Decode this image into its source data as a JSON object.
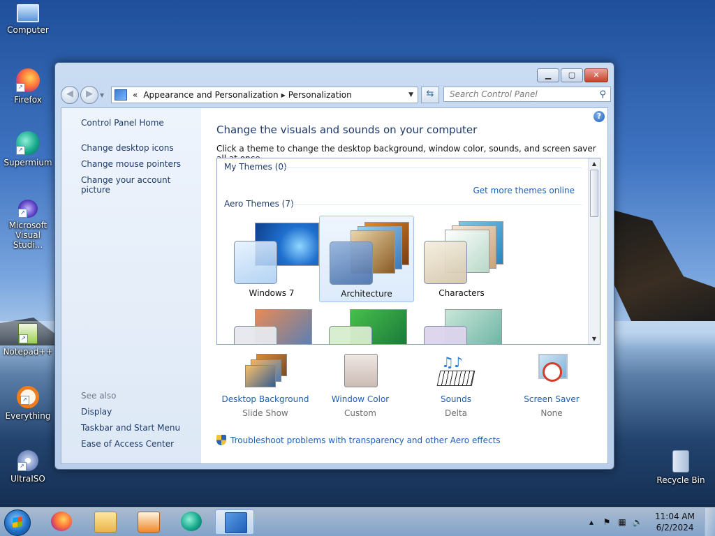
{
  "desktop": {
    "icons": [
      {
        "label": "Computer",
        "icon": "computer-icon"
      },
      {
        "label": "Firefox",
        "icon": "firefox-icon"
      },
      {
        "label": "Supermium",
        "icon": "supermium-icon"
      },
      {
        "label_line1": "Microsoft",
        "label_line2": "Visual Studi...",
        "icon": "visual-studio-icon"
      },
      {
        "label": "Notepad++",
        "icon": "notepad-plus-plus-icon"
      },
      {
        "label": "Everything",
        "icon": "everything-search-icon"
      },
      {
        "label": "UltraISO",
        "icon": "ultraiso-icon"
      },
      {
        "label": "Recycle Bin",
        "icon": "recycle-bin-icon"
      }
    ]
  },
  "window": {
    "address": {
      "chevron": "«",
      "crumbs": [
        "Appearance and Personalization",
        "Personalization"
      ]
    },
    "search_placeholder": "Search Control Panel",
    "left_pane": {
      "home": "Control Panel Home",
      "links": [
        "Change desktop icons",
        "Change mouse pointers",
        "Change your account picture"
      ],
      "see_also_heading": "See also",
      "see_also": [
        "Display",
        "Taskbar and Start Menu",
        "Ease of Access Center"
      ]
    },
    "main": {
      "title": "Change the visuals and sounds on your computer",
      "description": "Click a theme to change the desktop background, window color, sounds, and screen saver all at once.",
      "my_themes": "My Themes (0)",
      "get_more": "Get more themes online",
      "aero_themes": "Aero Themes (7)",
      "themes": [
        {
          "name": "Windows 7",
          "selected": false
        },
        {
          "name": "Architecture",
          "selected": true
        },
        {
          "name": "Characters",
          "selected": false
        }
      ]
    },
    "bottom": [
      {
        "label": "Desktop Background",
        "sub": "Slide Show",
        "icon": "desktop-background-icon"
      },
      {
        "label": "Window Color",
        "sub": "Custom",
        "icon": "window-color-icon",
        "color": "#d9c9c3"
      },
      {
        "label": "Sounds",
        "sub": "Delta",
        "icon": "sounds-icon"
      },
      {
        "label": "Screen Saver",
        "sub": "None",
        "icon": "screen-saver-icon"
      }
    ],
    "troubleshoot": "Troubleshoot problems with transparency and other Aero effects"
  },
  "taskbar": {
    "time": "11:04 AM",
    "date": "6/2/2024"
  },
  "colors": {
    "link": "#1c5fb8",
    "heading": "#1e3a69"
  }
}
